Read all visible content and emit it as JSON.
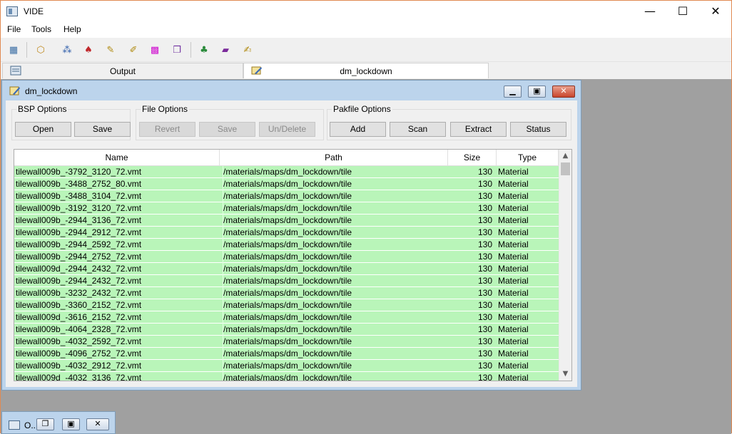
{
  "app": {
    "title": "VIDE",
    "minimize_glyph": "—",
    "maximize_glyph": "☐",
    "close_glyph": "✕"
  },
  "menu": [
    "File",
    "Tools",
    "Help"
  ],
  "toolbar": {
    "buttons": [
      {
        "icon": "layout-icon",
        "glyph": "▦",
        "color": "#3b6ea5"
      },
      {
        "icon": "package-icon",
        "glyph": "⬡",
        "color": "#c08a20"
      },
      {
        "icon": "molecule-icon",
        "glyph": "⁂",
        "color": "#2a5aa8"
      },
      {
        "icon": "mushroom-icon",
        "glyph": "♠",
        "color": "#c0282c"
      },
      {
        "icon": "edit-note-icon",
        "glyph": "✎",
        "color": "#b08a10"
      },
      {
        "icon": "edit-note-2-icon",
        "glyph": "✐",
        "color": "#b08a10"
      },
      {
        "icon": "checker-texture-icon",
        "glyph": "▩",
        "color": "#d010d0"
      },
      {
        "icon": "image-stack-icon",
        "glyph": "❐",
        "color": "#7030a0"
      },
      {
        "icon": "tree-icon",
        "glyph": "♣",
        "color": "#2a8a3a"
      },
      {
        "icon": "book-icon",
        "glyph": "▰",
        "color": "#7a2a9a"
      },
      {
        "icon": "map-edit-icon",
        "glyph": "✍",
        "color": "#b08a10"
      }
    ]
  },
  "tabs": [
    {
      "label": "Output",
      "icon": "output-icon"
    },
    {
      "label": "dm_lockdown",
      "icon": "map-icon"
    }
  ],
  "child": {
    "title": "dm_lockdown",
    "groups": {
      "bsp": {
        "label": "BSP Options",
        "buttons": [
          "Open",
          "Save"
        ]
      },
      "file": {
        "label": "File Options",
        "buttons": [
          "Revert",
          "Save",
          "Un/Delete"
        ]
      },
      "pak": {
        "label": "Pakfile Options",
        "buttons": [
          "Add",
          "Scan",
          "Extract",
          "Status"
        ]
      }
    },
    "table": {
      "columns": [
        "Name",
        "Path",
        "Size",
        "Type"
      ],
      "rows": [
        [
          "tilewall009b_-3792_3120_72.vmt",
          "/materials/maps/dm_lockdown/tile",
          "130",
          "Material"
        ],
        [
          "tilewall009b_-3488_2752_80.vmt",
          "/materials/maps/dm_lockdown/tile",
          "130",
          "Material"
        ],
        [
          "tilewall009b_-3488_3104_72.vmt",
          "/materials/maps/dm_lockdown/tile",
          "130",
          "Material"
        ],
        [
          "tilewall009b_-3192_3120_72.vmt",
          "/materials/maps/dm_lockdown/tile",
          "130",
          "Material"
        ],
        [
          "tilewall009b_-2944_3136_72.vmt",
          "/materials/maps/dm_lockdown/tile",
          "130",
          "Material"
        ],
        [
          "tilewall009b_-2944_2912_72.vmt",
          "/materials/maps/dm_lockdown/tile",
          "130",
          "Material"
        ],
        [
          "tilewall009b_-2944_2592_72.vmt",
          "/materials/maps/dm_lockdown/tile",
          "130",
          "Material"
        ],
        [
          "tilewall009b_-2944_2752_72.vmt",
          "/materials/maps/dm_lockdown/tile",
          "130",
          "Material"
        ],
        [
          "tilewall009d_-2944_2432_72.vmt",
          "/materials/maps/dm_lockdown/tile",
          "130",
          "Material"
        ],
        [
          "tilewall009b_-2944_2432_72.vmt",
          "/materials/maps/dm_lockdown/tile",
          "130",
          "Material"
        ],
        [
          "tilewall009b_-3232_2432_72.vmt",
          "/materials/maps/dm_lockdown/tile",
          "130",
          "Material"
        ],
        [
          "tilewall009b_-3360_2152_72.vmt",
          "/materials/maps/dm_lockdown/tile",
          "130",
          "Material"
        ],
        [
          "tilewall009d_-3616_2152_72.vmt",
          "/materials/maps/dm_lockdown/tile",
          "130",
          "Material"
        ],
        [
          "tilewall009b_-4064_2328_72.vmt",
          "/materials/maps/dm_lockdown/tile",
          "130",
          "Material"
        ],
        [
          "tilewall009b_-4032_2592_72.vmt",
          "/materials/maps/dm_lockdown/tile",
          "130",
          "Material"
        ],
        [
          "tilewall009b_-4096_2752_72.vmt",
          "/materials/maps/dm_lockdown/tile",
          "130",
          "Material"
        ],
        [
          "tilewall009b_-4032_2912_72.vmt",
          "/materials/maps/dm_lockdown/tile",
          "130",
          "Material"
        ],
        [
          "tilewall009d_-4032_3136_72.vmt",
          "/materials/maps/dm_lockdown/tile",
          "130",
          "Material"
        ]
      ]
    }
  },
  "minimized": {
    "title": "O..."
  },
  "colors": {
    "row_bg": "#b9f5b9",
    "mdi_bg": "#a0a0a0",
    "child_frame": "#bcd4ec"
  }
}
